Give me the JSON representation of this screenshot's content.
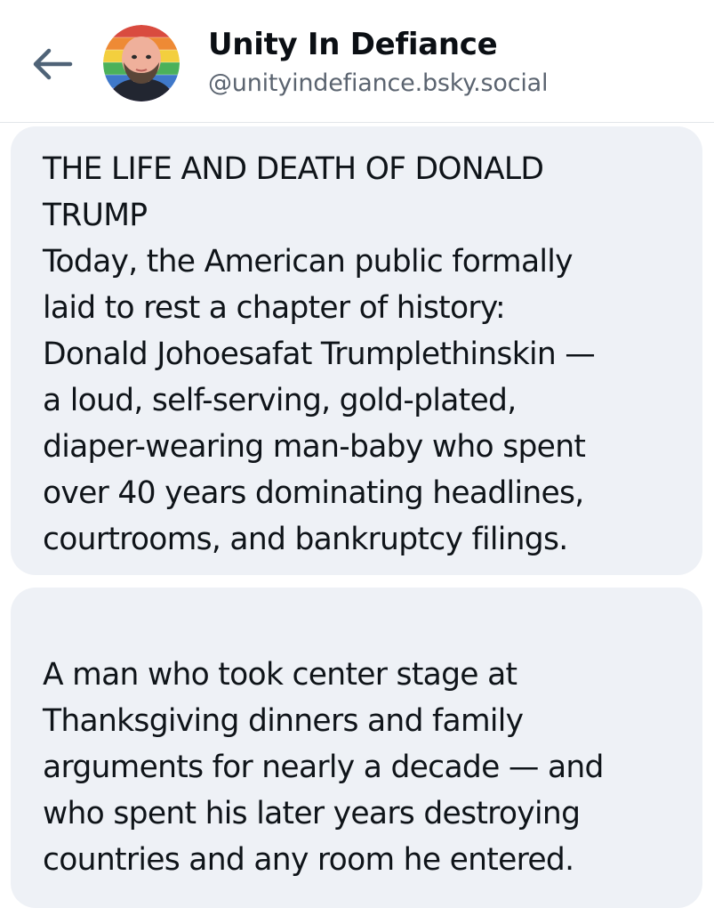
{
  "profile": {
    "display_name": "Unity In Defiance",
    "handle": "@unityindefiance.bsky.social",
    "back_icon": "arrow-left-icon",
    "accent_color": "#4f6377"
  },
  "post": {
    "card1_lines": [
      "THE LIFE AND DEATH OF DONALD",
      "TRUMP",
      "Today, the American public formally",
      "laid to rest a chapter of history:",
      "Donald Johoesafat Trumplethinskin —",
      "a loud, self-serving, gold-plated,",
      "diaper-wearing man-baby who spent",
      "over 40 years dominating headlines,",
      "courtrooms, and bankruptcy filings."
    ],
    "card2_lines": [
      "A man who took center stage at",
      "Thanksgiving dinners and family",
      "arguments for nearly a decade — and",
      "who spent his later years destroying",
      "countries and any room he entered."
    ]
  }
}
